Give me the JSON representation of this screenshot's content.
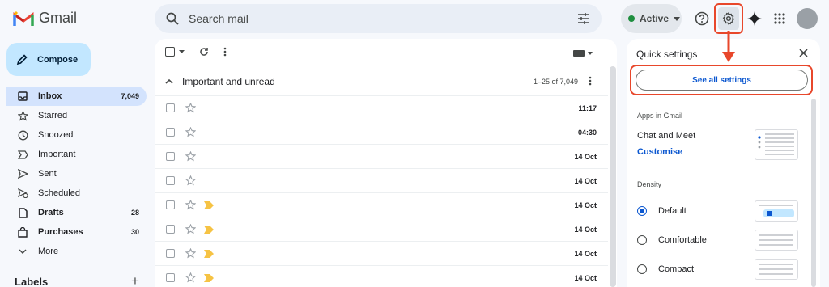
{
  "header": {
    "logo_text": "Gmail",
    "search_placeholder": "Search mail",
    "status_label": "Active",
    "status_color": "#1e8e3e"
  },
  "icons": [
    "menu-icon",
    "gmail-logo-icon",
    "search-icon",
    "search-options-icon",
    "help-icon",
    "gear-icon",
    "gemini-sparkle-icon",
    "apps-grid-icon",
    "avatar"
  ],
  "sidebar": {
    "compose_label": "Compose",
    "items": [
      {
        "label": "Inbox",
        "count": "7,049",
        "icon": "inbox-icon",
        "selected": true,
        "bold": true
      },
      {
        "label": "Starred",
        "count": "",
        "icon": "star-icon",
        "bold": false
      },
      {
        "label": "Snoozed",
        "count": "",
        "icon": "clock-icon",
        "bold": false
      },
      {
        "label": "Important",
        "count": "",
        "icon": "important-icon",
        "bold": false
      },
      {
        "label": "Sent",
        "count": "",
        "icon": "send-icon",
        "bold": false
      },
      {
        "label": "Scheduled",
        "count": "",
        "icon": "scheduled-icon",
        "bold": false
      },
      {
        "label": "Drafts",
        "count": "28",
        "icon": "draft-icon",
        "bold": true
      },
      {
        "label": "Purchases",
        "count": "30",
        "icon": "purchases-icon",
        "bold": true
      },
      {
        "label": "More",
        "count": "",
        "icon": "chevron-down-icon",
        "bold": false
      }
    ],
    "labels_heading": "Labels",
    "labels_add": "+"
  },
  "main": {
    "section_title": "Important and unread",
    "range": "1–25 of 7,049",
    "rows": [
      {
        "date": "11:17",
        "important": false
      },
      {
        "date": "04:30",
        "important": false
      },
      {
        "date": "14 Oct",
        "important": false
      },
      {
        "date": "14 Oct",
        "important": false
      },
      {
        "date": "14 Oct",
        "important": true
      },
      {
        "date": "14 Oct",
        "important": true
      },
      {
        "date": "14 Oct",
        "important": true
      },
      {
        "date": "14 Oct",
        "important": true
      }
    ]
  },
  "quick_settings": {
    "title": "Quick settings",
    "see_all": "See all settings",
    "apps_heading": "Apps in Gmail",
    "chat_meet": "Chat and Meet",
    "customise": "Customise",
    "density_heading": "Density",
    "density_options": [
      {
        "label": "Default",
        "selected": true
      },
      {
        "label": "Comfortable",
        "selected": false
      },
      {
        "label": "Compact",
        "selected": false
      }
    ]
  },
  "colors": {
    "accent": "#0b57d0",
    "annotation": "#e8472b",
    "selected_nav": "#d3e3fd",
    "compose_bg": "#c2e7ff",
    "important_marker": "#f6c344"
  }
}
